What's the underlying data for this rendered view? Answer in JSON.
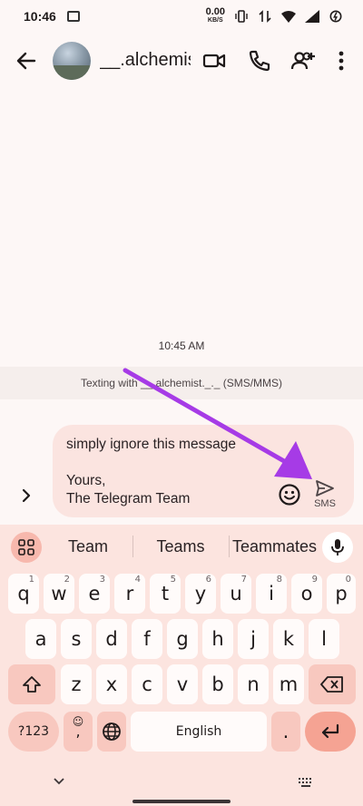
{
  "status": {
    "time": "10:46",
    "speed_value": "0.00",
    "speed_unit": "KB/S"
  },
  "header": {
    "contact_name": "__.alchemist._._"
  },
  "conversation": {
    "timestamp": "10:45 AM",
    "texting_banner": "Texting with __.alchemist._._ (SMS/MMS)"
  },
  "compose": {
    "text": "simply ignore this message\n\nYours,\nThe Telegram Team",
    "send_label": "SMS"
  },
  "keyboard": {
    "suggestions": [
      "Team",
      "Teams",
      "Teammates"
    ],
    "row1": [
      {
        "k": "q",
        "h": "1"
      },
      {
        "k": "w",
        "h": "2"
      },
      {
        "k": "e",
        "h": "3"
      },
      {
        "k": "r",
        "h": "4"
      },
      {
        "k": "t",
        "h": "5"
      },
      {
        "k": "y",
        "h": "6"
      },
      {
        "k": "u",
        "h": "7"
      },
      {
        "k": "i",
        "h": "8"
      },
      {
        "k": "o",
        "h": "9"
      },
      {
        "k": "p",
        "h": "0"
      }
    ],
    "row2": [
      "a",
      "s",
      "d",
      "f",
      "g",
      "h",
      "j",
      "k",
      "l"
    ],
    "row3": [
      "z",
      "x",
      "c",
      "v",
      "b",
      "n",
      "m"
    ],
    "symbols_label": "?123",
    "comma_label": ",",
    "space_label": "English",
    "period_label": "."
  },
  "colors": {
    "accent": "#f5a393",
    "keyboard_bg": "#fce4df",
    "compose_bg": "#fbe4e0",
    "arrow": "#a63be6"
  }
}
